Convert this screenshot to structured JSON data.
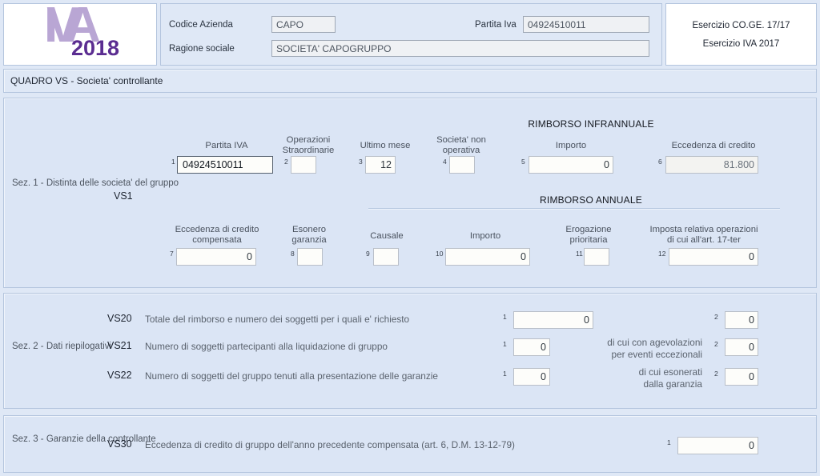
{
  "logo": {
    "mark": "IVA",
    "year": "2018"
  },
  "header": {
    "codice_azienda_label": "Codice  Azienda",
    "codice_azienda_value": "CAPO",
    "ragione_sociale_label": "Ragione sociale",
    "ragione_sociale_value": "SOCIETA' CAPOGRUPPO",
    "partita_iva_label": "Partita Iva",
    "partita_iva_value": "04924510011",
    "esercizio_coge": "Esercizio CO.GE. 17/17",
    "esercizio_iva": "Esercizio IVA 2017"
  },
  "quadro": {
    "title": "QUADRO VS - Societa' controllante"
  },
  "sez1": {
    "label": "Sez.  1 - Distinta\ndelle  societa'\ndel gruppo",
    "code": "VS1",
    "banner_infrannuale": "RIMBORSO INFRANNUALE",
    "banner_annuale": "RIMBORSO ANNUALE",
    "row1": [
      {
        "num": "1",
        "caption": "Partita IVA",
        "value": "04924510011",
        "align": "left",
        "state": "focus"
      },
      {
        "num": "2",
        "caption": "Operazioni\nStraordinarie",
        "value": "",
        "align": "right",
        "state": "normal"
      },
      {
        "num": "3",
        "caption": "Ultimo mese",
        "value": "12",
        "align": "right",
        "state": "normal"
      },
      {
        "num": "4",
        "caption": "Societa'  non\noperativa",
        "value": "",
        "align": "right",
        "state": "normal"
      },
      {
        "num": "5",
        "caption": "Importo",
        "value": "0",
        "align": "right",
        "state": "normal"
      },
      {
        "num": "6",
        "caption": "Eccedenza di credito",
        "value": "81.800",
        "align": "right",
        "state": "readonly"
      }
    ],
    "row2": [
      {
        "num": "7",
        "caption": "Eccedenza  di   credito\ncompensata",
        "value": "0",
        "align": "right",
        "state": "normal"
      },
      {
        "num": "8",
        "caption": "Esonero\ngaranzia",
        "value": "",
        "align": "right",
        "state": "normal"
      },
      {
        "num": "9",
        "caption": "Causale",
        "value": "",
        "align": "right",
        "state": "normal"
      },
      {
        "num": "10",
        "caption": "Importo",
        "value": "0",
        "align": "right",
        "state": "normal"
      },
      {
        "num": "11",
        "caption": "Erogazione\nprioritaria",
        "value": "",
        "align": "right",
        "state": "normal"
      },
      {
        "num": "12",
        "caption": "Imposta  relativa  operazioni\ndi cui all'art. 17-ter",
        "value": "0",
        "align": "right",
        "state": "normal"
      }
    ]
  },
  "sez2": {
    "label": "Sez.  2 - Dati\nriepilogativi",
    "rows": [
      {
        "code": "VS20",
        "text": "Totale del rimborso e numero dei soggetti per i quali e' richiesto",
        "f1_num": "1",
        "f1_value": "0",
        "mid_text": "",
        "f2_num": "2",
        "f2_value": "0"
      },
      {
        "code": "VS21",
        "text": "Numero di soggetti partecipanti alla liquidazione di gruppo",
        "f1_num": "1",
        "f1_value": "0",
        "mid_text": "di cui con  agevolazioni\nper eventi eccezionali",
        "f2_num": "2",
        "f2_value": "0"
      },
      {
        "code": "VS22",
        "text": "Numero di soggetti  del gruppo tenuti alla  presentazione delle garanzie",
        "f1_num": "1",
        "f1_value": "0",
        "mid_text": "di  cui  esonerati\ndalla garanzia",
        "f2_num": "2",
        "f2_value": "0"
      }
    ]
  },
  "sez3": {
    "label": "Sez.  3 - Garanzie\ndella controllante",
    "code": "VS30",
    "text": "Eccedenza di  credito di  gruppo  dell'anno  precedente  compensata (art.  6,  D.M.  13-12-79)",
    "f1_num": "1",
    "f1_value": "0"
  }
}
